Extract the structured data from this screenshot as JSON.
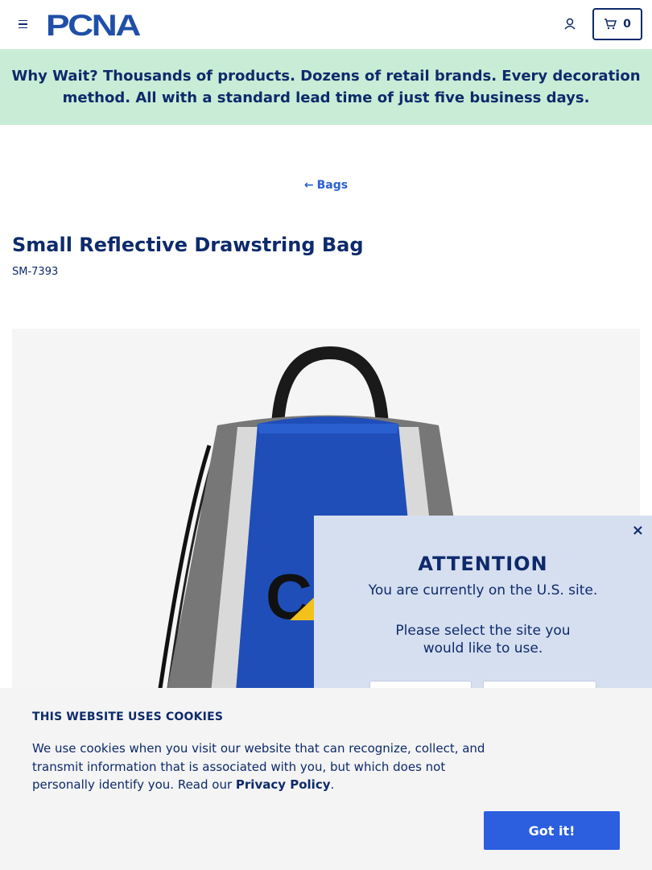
{
  "header": {
    "logo_text": "PCNA",
    "cart_count": "0"
  },
  "banner": {
    "lead": "Why Wait?",
    "text": " Thousands of products. Dozens of retail brands. Every decoration method. All with a standard lead time of just five business days."
  },
  "breadcrumb": {
    "label": "Bags"
  },
  "product": {
    "title": "Small Reflective Drawstring Bag",
    "sku": "SM-7393",
    "image_logo_text": "CA"
  },
  "site_modal": {
    "close": "×",
    "heading": "ATTENTION",
    "line1": "You are currently on the U.S. site.",
    "line2": "Please select the site you would like to use."
  },
  "cookie_banner": {
    "heading": "THIS WEBSITE USES COOKIES",
    "text": "We use cookies when you visit our website that can recognize, collect, and transmit information that is associated with you, but which does not personally identify you. Read our ",
    "link": "Privacy Policy",
    "period": ".",
    "button": "Got it!"
  }
}
